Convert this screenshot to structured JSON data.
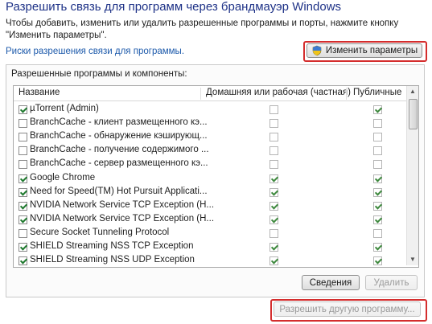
{
  "title": "Разрешить связь для программ через брандмауэр Windows",
  "description": "Чтобы добавить, изменить или удалить разрешенные программы и порты, нажмите кнопку \"Изменить параметры\".",
  "risk_link": "Риски разрешения связи для программы.",
  "change_settings_button": "Изменить параметры",
  "group_label": "Разрешенные программы и компоненты:",
  "columns": {
    "name": "Название",
    "private": "Домашняя или рабочая (частная)",
    "public": "Публичные"
  },
  "rows": [
    {
      "name": "µTorrent (Admin)",
      "enabled": true,
      "private": false,
      "public": true
    },
    {
      "name": "BranchCache - клиент размещенного кэ...",
      "enabled": false,
      "private": false,
      "public": false
    },
    {
      "name": "BranchCache - обнаружение кэширующ...",
      "enabled": false,
      "private": false,
      "public": false
    },
    {
      "name": "BranchCache - получение содержимого ...",
      "enabled": false,
      "private": false,
      "public": false
    },
    {
      "name": "BranchCache - сервер размещенного кэ...",
      "enabled": false,
      "private": false,
      "public": false
    },
    {
      "name": "Google Chrome",
      "enabled": true,
      "private": true,
      "public": true
    },
    {
      "name": "Need for Speed(TM) Hot Pursuit Applicati...",
      "enabled": true,
      "private": true,
      "public": true
    },
    {
      "name": "NVIDIA Network Service TCP Exception (H...",
      "enabled": true,
      "private": true,
      "public": true
    },
    {
      "name": "NVIDIA Network Service TCP Exception (H...",
      "enabled": true,
      "private": true,
      "public": true
    },
    {
      "name": "Secure Socket Tunneling Protocol",
      "enabled": false,
      "private": false,
      "public": false
    },
    {
      "name": "SHIELD Streaming NSS TCP Exception",
      "enabled": true,
      "private": true,
      "public": true
    },
    {
      "name": "SHIELD Streaming NSS UDP Exception",
      "enabled": true,
      "private": true,
      "public": true
    }
  ],
  "details_button": "Сведения",
  "remove_button": "Удалить",
  "allow_another_button": "Разрешить другую программу...",
  "colors": {
    "title": "#1e3287",
    "link": "#1d5aab",
    "highlight": "#d42d2d",
    "check": "#1f7a2f"
  },
  "icons": {
    "change_settings": "shield-icon"
  }
}
